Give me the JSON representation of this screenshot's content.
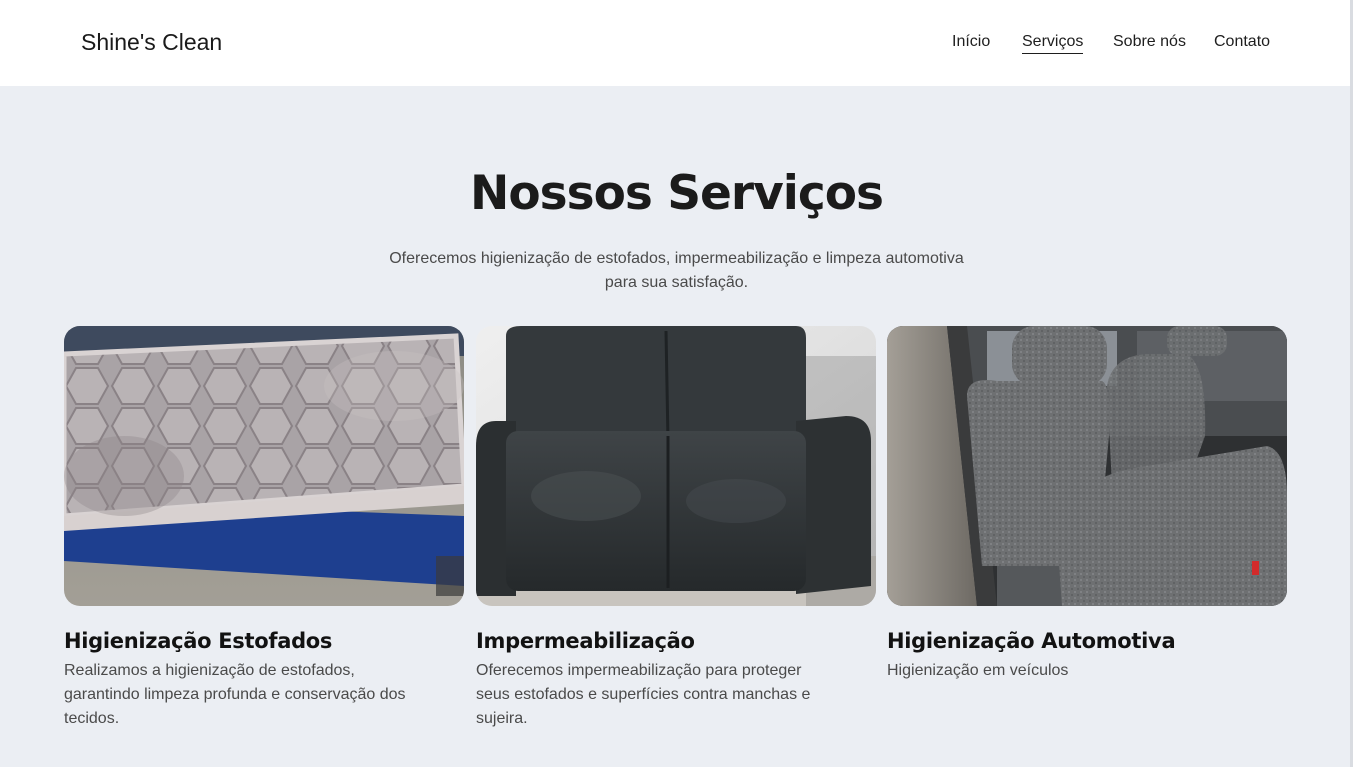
{
  "header": {
    "brand": "Shine's Clean",
    "nav": [
      {
        "label": "Início",
        "active": false
      },
      {
        "label": "Serviços",
        "active": true
      },
      {
        "label": "Sobre nós",
        "active": false
      },
      {
        "label": "Contato",
        "active": false
      }
    ]
  },
  "services": {
    "title": "Nossos Serviços",
    "intro": "Oferecemos higienização de estofados, impermeabilização e limpeza automotiva para sua satisfação.",
    "cards": [
      {
        "title": "Higienização Estofados",
        "text": "Realizamos a higienização de estofados, garantindo limpeza profunda e conservação dos tecidos.",
        "image": "mattress-photo"
      },
      {
        "title": "Impermeabilização",
        "text": "Oferecemos impermeabilização para proteger seus estofados e superfícies contra manchas e sujeira.",
        "image": "sofa-photo"
      },
      {
        "title": "Higienização Automotiva",
        "text": "Higienização em veículos",
        "image": "car-interior-photo"
      }
    ]
  },
  "colors": {
    "background": "#ebeef3",
    "header": "#ffffff",
    "text": "#1b1b1b",
    "muted": "#4a4a4a"
  }
}
